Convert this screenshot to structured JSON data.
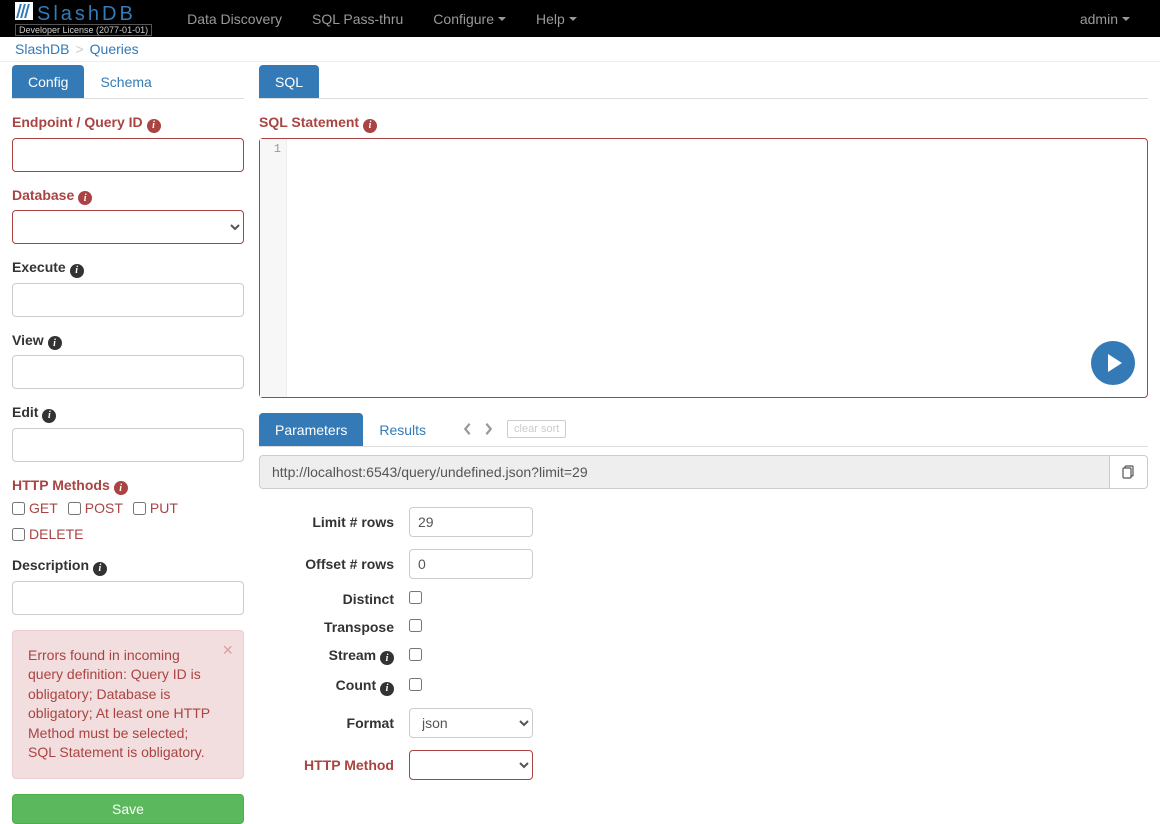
{
  "navbar": {
    "brand": "SlashDB",
    "license": "Developer License (2077-01-01)",
    "links": [
      {
        "label": "Data Discovery",
        "dropdown": false
      },
      {
        "label": "SQL Pass-thru",
        "dropdown": false
      },
      {
        "label": "Configure",
        "dropdown": true
      },
      {
        "label": "Help",
        "dropdown": true
      }
    ],
    "user": "admin"
  },
  "breadcrumb": {
    "items": [
      "SlashDB",
      "Queries"
    ]
  },
  "left": {
    "tabs": [
      {
        "label": "Config",
        "active": true
      },
      {
        "label": "Schema",
        "active": false
      }
    ],
    "endpoint_label": "Endpoint / Query ID",
    "database_label": "Database",
    "execute_label": "Execute",
    "view_label": "View",
    "edit_label": "Edit",
    "http_methods_label": "HTTP Methods",
    "methods": [
      "GET",
      "POST",
      "PUT",
      "DELETE"
    ],
    "description_label": "Description",
    "error_msg": "Errors found in incoming query definition: Query ID is obligatory; Database is obligatory; At least one HTTP Method must be selected; SQL Statement is obligatory.",
    "save_label": "Save"
  },
  "right": {
    "tabs": [
      {
        "label": "SQL",
        "active": true
      }
    ],
    "sql_label": "SQL Statement",
    "gutter_line": "1",
    "subtabs": [
      {
        "label": "Parameters",
        "active": true
      },
      {
        "label": "Results",
        "active": false
      }
    ],
    "clear_sort": "clear sort",
    "url": "http://localhost:6543/query/undefined.json?limit=29",
    "params": {
      "limit_label": "Limit # rows",
      "limit_value": "29",
      "offset_label": "Offset # rows",
      "offset_value": "0",
      "distinct_label": "Distinct",
      "transpose_label": "Transpose",
      "stream_label": "Stream",
      "count_label": "Count",
      "format_label": "Format",
      "format_value": "json",
      "http_method_label": "HTTP Method"
    }
  }
}
